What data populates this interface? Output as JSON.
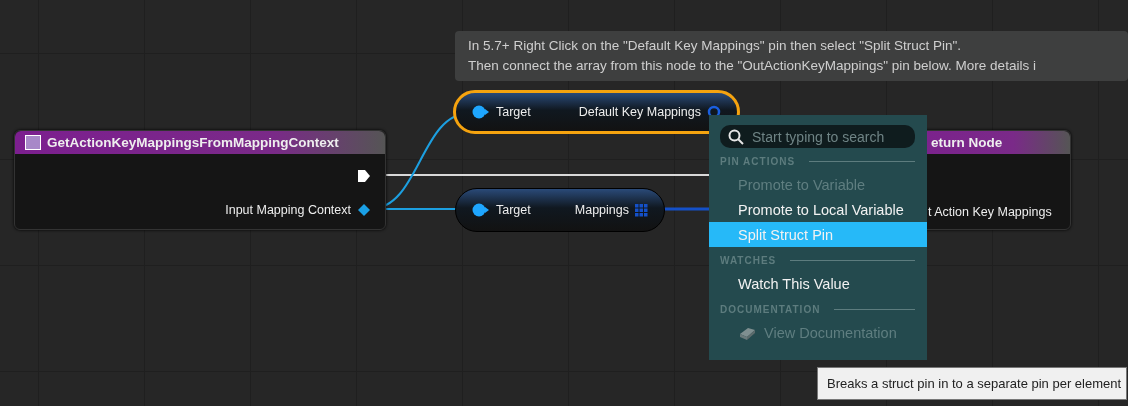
{
  "comment": {
    "lines": [
      "In 5.7+ Right Click on the \"Default Key Mappings\" pin then select \"Split Struct Pin\".",
      "Then connect the array from this node to the \"OutActionKeyMappings\" pin below. More details i"
    ]
  },
  "function_node": {
    "title": "GetActionKeyMappingsFromMappingContext",
    "pins": [
      {
        "kind": "exec"
      },
      {
        "kind": "object_in",
        "label": "Input Mapping Context"
      }
    ]
  },
  "pure_nodes": [
    {
      "selected": true,
      "target": "Target",
      "output": "Default Key Mappings",
      "kind": "struct"
    },
    {
      "selected": false,
      "target": "Target",
      "output": "Mappings",
      "kind": "array"
    }
  ],
  "return_node": {
    "title": "eturn Node",
    "pins": [
      "t Action Key Mappings"
    ]
  },
  "menu": {
    "search": {
      "placeholder": "Start typing to search"
    },
    "sections": [
      {
        "title": "PIN ACTIONS",
        "items": [
          {
            "label": "Promote to Variable",
            "kind": "plain",
            "disabled": true,
            "selected": false
          },
          {
            "label": "Promote to Local Variable",
            "kind": "plain",
            "disabled": false,
            "selected": false
          },
          {
            "label": "Split Struct Pin",
            "kind": "plain",
            "disabled": false,
            "selected": true
          }
        ]
      },
      {
        "title": "WATCHES",
        "items": [
          {
            "label": "Watch This Value",
            "kind": "plain",
            "disabled": false,
            "selected": false
          }
        ]
      },
      {
        "title": "DOCUMENTATION",
        "items": [
          {
            "label": "View Documentation",
            "kind": "book",
            "disabled": true,
            "selected": false
          }
        ]
      }
    ]
  },
  "tooltip": {
    "text": "Breaks a struct pin in to a separate pin per element"
  }
}
